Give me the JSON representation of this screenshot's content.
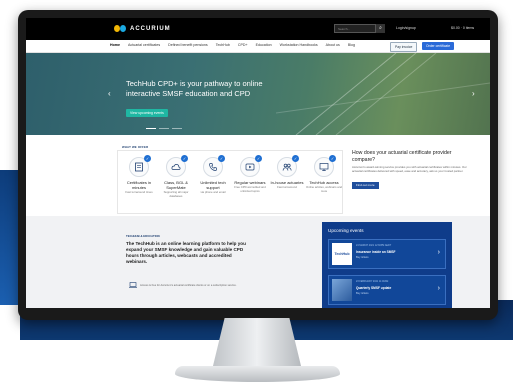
{
  "topbar": {
    "logo_text": "ACCURIUM",
    "search_placeholder": "Search...",
    "login": "Login/signup",
    "cart": "$0.00 · 0 items"
  },
  "nav": {
    "items": [
      "Home",
      "Actuarial certificates",
      "Defined benefit pensions",
      "TechHub",
      "CPD+",
      "Education",
      "Workstation Handbooks",
      "About us",
      "Blog"
    ],
    "pay_invoice": "Pay invoice",
    "order_certificate": "Order certificate"
  },
  "hero": {
    "title": "TechHub CPD+ is your pathway to online interactive SMSF education and CPD",
    "button": "View upcoming events"
  },
  "features": {
    "label": "WHAT WE OFFER",
    "items": [
      {
        "title": "Certificates in minutes",
        "sub": "Fast turnaround times",
        "icon": "certificate-icon"
      },
      {
        "title": "Class, BGL & SuperMate",
        "sub": "Supporting all major databases",
        "icon": "cloud-icon"
      },
      {
        "title": "Unlimited tech support",
        "sub": "via phone and email",
        "icon": "phone-icon"
      },
      {
        "title": "Regular webinars",
        "sub": "Free CPD accredited and unlimited topics",
        "icon": "play-icon"
      },
      {
        "title": "In-house actuaries",
        "sub": "Fast turnaround",
        "icon": "people-icon"
      },
      {
        "title": "TechHub access",
        "sub": "Online articles, webinars and more",
        "icon": "monitor-icon"
      }
    ]
  },
  "promo": {
    "title": "How does your actuarial certificate provider compare?",
    "text": "Accurium's award-winning service provides you with actuarial certificates within minutes. Our actuarial certificates delivered with speed, ease and accuracy, ask us your trusted partner.",
    "button": "Find out more"
  },
  "techhub": {
    "label": "TECHHUB & EDUCATION",
    "text": "The TechHub is an online learning platform to help you expand your SMSF knowledge and gain valuable CPD hours through articles, webcasts and accredited webinars.",
    "footnote": "Access is free for Accurium's actuarial certificate clients or on a subscription service."
  },
  "upcoming": {
    "title": "Upcoming events",
    "items": [
      {
        "meta": "24 MARCH 2021 12:30PM AEDT",
        "name": "Insurance inside an SMSF",
        "link": "Buy tickets",
        "thumb": "TechHub"
      },
      {
        "meta": "23 FEBRUARY 2021 11:00AM",
        "name": "Quarterly SMSF update",
        "link": "Buy tickets",
        "thumb": ""
      }
    ]
  },
  "colors": {
    "accent": "#1f6fd2",
    "navy": "#0f3c8a",
    "teal": "#1fb7a3"
  }
}
